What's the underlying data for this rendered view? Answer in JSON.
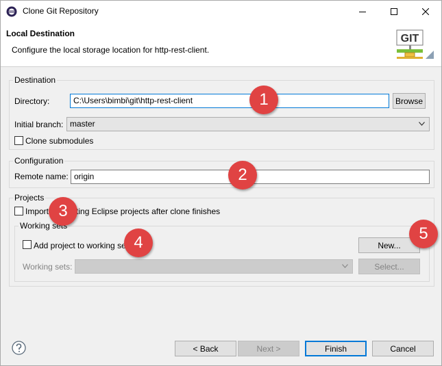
{
  "window": {
    "title": "Clone Git Repository"
  },
  "header": {
    "title": "Local Destination",
    "description": "Configure the local storage location for http-rest-client.",
    "logo_text": "GIT"
  },
  "destination": {
    "legend": "Destination",
    "directory_label": "Directory:",
    "directory_value": "C:\\Users\\bimbi\\git\\http-rest-client",
    "browse_label": "Browse",
    "branch_label": "Initial branch:",
    "branch_value": "master",
    "submodules_label": "Clone submodules"
  },
  "configuration": {
    "legend": "Configuration",
    "remote_label": "Remote name:",
    "remote_value": "origin"
  },
  "projects": {
    "legend": "Projects",
    "import_label": "Import all existing Eclipse projects after clone finishes",
    "working_sets": {
      "legend": "Working sets",
      "add_label": "Add project to working sets",
      "new_label": "New...",
      "sets_label": "Working sets:",
      "select_label": "Select..."
    }
  },
  "footer": {
    "back_label": "< Back",
    "next_label": "Next >",
    "finish_label": "Finish",
    "cancel_label": "Cancel"
  },
  "markers": [
    "1",
    "2",
    "3",
    "4",
    "5"
  ],
  "colors": {
    "marker": "#e04343",
    "focus": "#0078d7"
  }
}
